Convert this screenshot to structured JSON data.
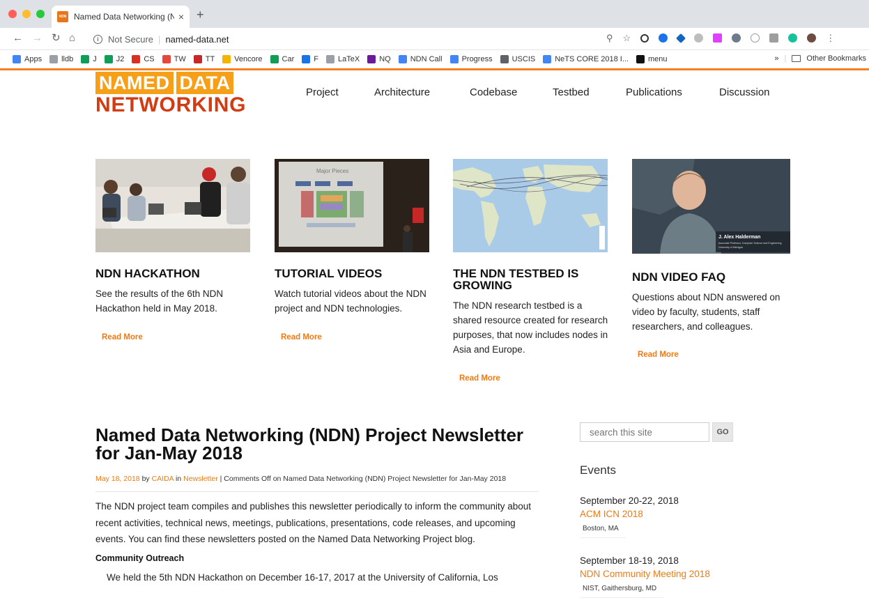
{
  "browser": {
    "tab_title": "Named Data Networking (NDN",
    "tab_favicon_text": "NDN",
    "tab_close": "×",
    "new_tab": "+",
    "security_label": "Not Secure",
    "url": "named-data.net",
    "bookmarks": [
      {
        "label": "Apps",
        "icon": "apps-grid-icon",
        "color": "#4285f4"
      },
      {
        "label": "lldb",
        "icon": "page-icon",
        "color": "#9aa0a6"
      },
      {
        "label": "J",
        "icon": "sheets-icon",
        "color": "#0f9d58"
      },
      {
        "label": "J2",
        "icon": "sheets-icon",
        "color": "#0f9d58"
      },
      {
        "label": "CS",
        "icon": "arc-icon",
        "color": "#d93025"
      },
      {
        "label": "TW",
        "icon": "tw-icon",
        "color": "#e8453c"
      },
      {
        "label": "TT",
        "icon": "cherry-icon",
        "color": "#c62828"
      },
      {
        "label": "Vencore",
        "icon": "box-icon",
        "color": "#f4b400"
      },
      {
        "label": "Car",
        "icon": "car-icon",
        "color": "#0f9d58"
      },
      {
        "label": "F",
        "icon": "f-icon",
        "color": "#1a73e8"
      },
      {
        "label": "LaTeX",
        "icon": "page-icon",
        "color": "#9aa0a6"
      },
      {
        "label": "NQ",
        "icon": "peacock-icon",
        "color": "#6a1b9a"
      },
      {
        "label": "NDN Call",
        "icon": "docs-icon",
        "color": "#4285f4"
      },
      {
        "label": "Progress",
        "icon": "docs-icon",
        "color": "#4285f4"
      },
      {
        "label": "USCIS",
        "icon": "seal-icon",
        "color": "#5f6368"
      },
      {
        "label": "NeTS CORE 2018 I...",
        "icon": "docs-icon",
        "color": "#4285f4"
      },
      {
        "label": "menu",
        "icon": "italic-d-icon",
        "color": "#111111"
      }
    ],
    "bookmarks_overflow": "»",
    "other_bookmarks": "Other Bookmarks"
  },
  "logo": {
    "word1": "NAMED",
    "word2": "DATA",
    "word3": "NETWORKING"
  },
  "nav": {
    "project": "Project",
    "architecture": "Architecture",
    "codebase": "Codebase",
    "testbed": "Testbed",
    "publications": "Publications",
    "discussion": "Discussion"
  },
  "cards": [
    {
      "title": "NDN HACKATHON",
      "text": "See the results of the 6th NDN Hackathon held in May 2018.",
      "link": "Read More"
    },
    {
      "title": "TUTORIAL VIDEOS",
      "text": "Watch tutorial videos about the NDN project and NDN technologies.",
      "link": "Read More",
      "slide_title": "Major Pieces"
    },
    {
      "title": "THE NDN TESTBED IS GROWING",
      "text": "The NDN research testbed is a shared resource created for research purposes, that now includes nodes in Asia and Europe.",
      "link": "Read More"
    },
    {
      "title": "NDN VIDEO FAQ",
      "text": "Questions about NDN answered on video by faculty, students, staff researchers, and colleagues.",
      "link": "Read More",
      "caption_name": "J. Alex Halderman",
      "caption_role": "Associate Professor, Computer Science and Engineering",
      "caption_org": "University of Michigan"
    }
  ],
  "article": {
    "title": "Named Data Networking (NDN) Project Newsletter for Jan-May 2018",
    "date": "May 18, 2018",
    "by": "by",
    "author": "CAIDA",
    "in": "in",
    "category": "Newsletter",
    "comments": "| Comments Off on Named Data Networking (NDN) Project Newsletter for Jan-May 2018",
    "body": "The NDN project team compiles and publishes this newsletter periodically to inform the community about recent activities, technical news, meetings, publications, presentations, code releases, and upcoming events. You can find these newsletters posted on the Named Data Networking Project blog.",
    "section_heading": "Community Outreach",
    "section_text": "We held the 5th NDN Hackathon on December 16-17, 2017 at the University of California, Los"
  },
  "sidebar": {
    "search_placeholder": "search this site",
    "search_button": "GO",
    "events_title": "Events",
    "events": [
      {
        "date": "September 20-22, 2018",
        "name": "ACM ICN 2018",
        "location": "Boston, MA"
      },
      {
        "date": "September 18-19, 2018",
        "name": "NDN Community Meeting 2018",
        "location": "NIST, Gaithersburg, MD"
      }
    ]
  },
  "colors": {
    "accent_orange": "#f07a12",
    "logo_orange": "#f6a01a",
    "logo_red": "#d13c12"
  }
}
